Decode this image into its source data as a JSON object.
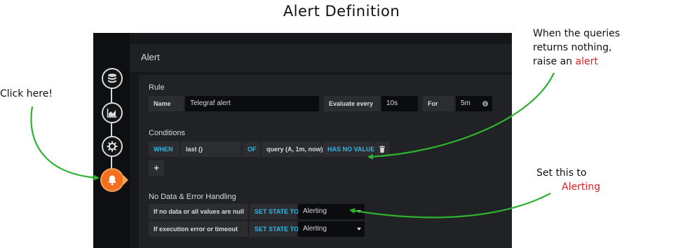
{
  "annotations": {
    "title": "Alert Definition",
    "click_here": "Click here!",
    "queries_line1": "When the queries",
    "queries_line2": "returns nothing,",
    "queries_line3_prefix": "raise an",
    "queries_line3_highlight": "alert",
    "set_line1": "Set this to",
    "set_highlight": "Alerting"
  },
  "colors": {
    "accent_blue": "#33b5e5",
    "alert_orange": "#f26f20",
    "annotation_red": "#e02020",
    "arrow_green": "#2db32d"
  },
  "sidebar": {
    "steps": [
      {
        "icon": "database-icon"
      },
      {
        "icon": "chart-icon"
      },
      {
        "icon": "gear-icon"
      },
      {
        "icon": "bell-icon",
        "active": true
      }
    ]
  },
  "header": {
    "title": "Alert"
  },
  "rule": {
    "section_title": "Rule",
    "name_label": "Name",
    "name_value": "Telegraf alert",
    "evaluate_label": "Evaluate every",
    "evaluate_value": "10s",
    "for_label": "For",
    "for_value": "5m"
  },
  "conditions": {
    "section_title": "Conditions",
    "when": "WHEN",
    "reducer": "last ()",
    "of": "OF",
    "query": "query (A, 1m, now)",
    "evaluator": "HAS NO VALUE",
    "add": "+"
  },
  "nodata": {
    "section_title": "No Data & Error Handling",
    "rows": [
      {
        "label": "If no data or all values are null",
        "set_state": "SET STATE TO",
        "value": "Alerting"
      },
      {
        "label": "If execution error or timeout",
        "set_state": "SET STATE TO",
        "value": "Alerting"
      }
    ]
  }
}
